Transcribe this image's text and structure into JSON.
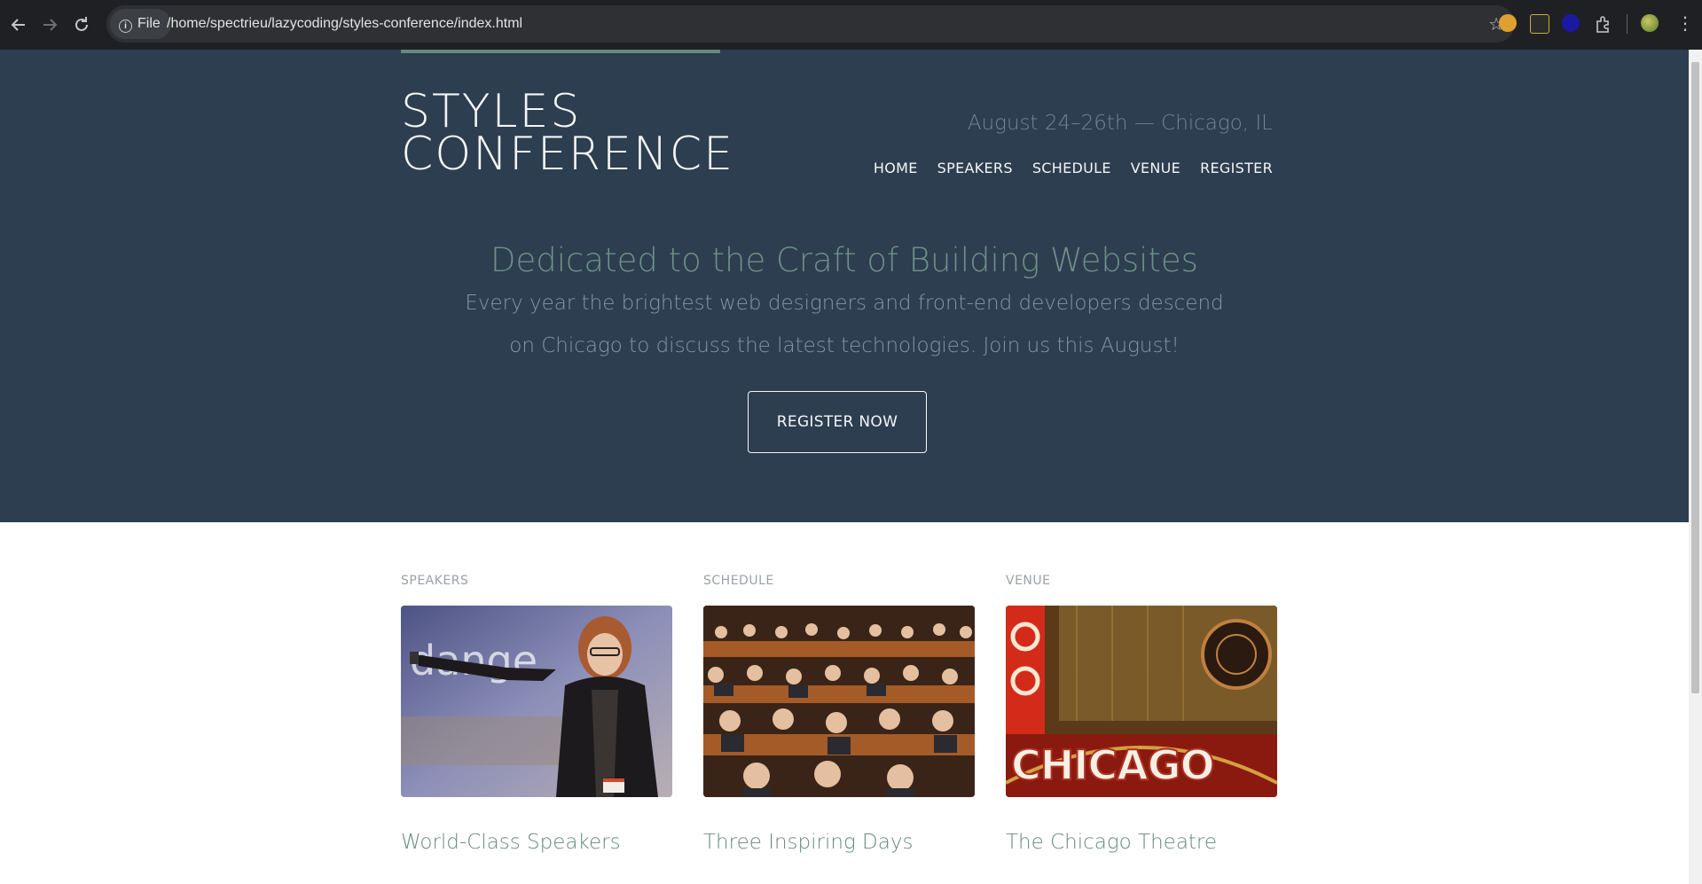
{
  "browser": {
    "site_chip_label": "File",
    "url": "/home/spectrieu/lazycoding/styles-conference/index.html"
  },
  "site": {
    "logo_line1": "STYLES",
    "logo_line2": "CONFERENCE",
    "tagline": "August 24–26th — Chicago, IL",
    "nav": [
      "HOME",
      "SPEAKERS",
      "SCHEDULE",
      "VENUE",
      "REGISTER"
    ]
  },
  "hero": {
    "headline": "Dedicated to the Craft of Building Websites",
    "lead": "Every year the brightest web designers and front-end developers descend on Chicago to discuss the latest technologies. Join us this August!",
    "cta": "REGISTER NOW"
  },
  "features": [
    {
      "label": "SPEAKERS",
      "title": "World-Class Speakers"
    },
    {
      "label": "SCHEDULE",
      "title": "Three Inspiring Days"
    },
    {
      "label": "VENUE",
      "title": "The Chicago Theatre"
    }
  ],
  "venue_sign_text": "CHICAGO",
  "speakers_screen_text": "dange",
  "colors": {
    "hero_bg": "#2c3e50",
    "accent": "#68897d",
    "browser_bg": "#1f2023"
  }
}
